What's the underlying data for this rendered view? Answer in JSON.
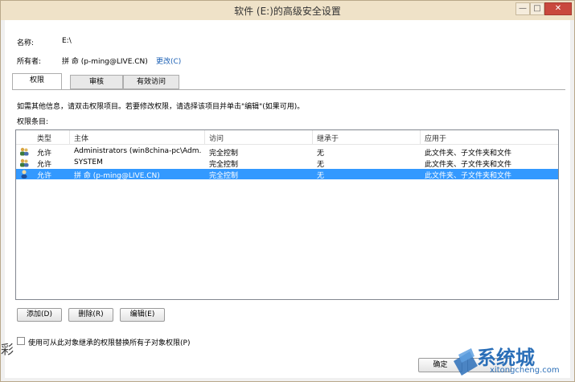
{
  "window": {
    "title": "软件 (E:)的高级安全设置",
    "min_glyph": "—",
    "max_glyph": "□",
    "close_glyph": "✕"
  },
  "header": {
    "name_label": "名称:",
    "name_value": "E:\\",
    "owner_label": "所有者:",
    "owner_value": "拼 命 (p-ming@LIVE.CN)",
    "change_link": "更改(C)"
  },
  "tabs": [
    {
      "label": "权限",
      "active": true
    },
    {
      "label": "审核",
      "active": false
    },
    {
      "label": "有效访问",
      "active": false
    }
  ],
  "info_text": "如需其他信息，请双击权限项目。若要修改权限，请选择该项目并单击\"编辑\"(如果可用)。",
  "entries_label": "权限条目:",
  "table": {
    "columns": [
      "类型",
      "主体",
      "访问",
      "继承于",
      "应用于"
    ],
    "rows": [
      {
        "type": "允许",
        "principal": "Administrators (win8china-pc\\Adm...",
        "access": "完全控制",
        "inherited": "无",
        "applies": "此文件夹、子文件夹和文件",
        "icon": "group-icon",
        "selected": false
      },
      {
        "type": "允许",
        "principal": "SYSTEM",
        "access": "完全控制",
        "inherited": "无",
        "applies": "此文件夹、子文件夹和文件",
        "icon": "group-icon",
        "selected": false
      },
      {
        "type": "允许",
        "principal": "拼 命 (p-ming@LIVE.CN)",
        "access": "完全控制",
        "inherited": "无",
        "applies": "此文件夹、子文件夹和文件",
        "icon": "user-icon",
        "selected": true
      }
    ]
  },
  "buttons": {
    "add": "添加(D)",
    "remove": "删除(R)",
    "edit": "编辑(E)"
  },
  "replace_checkbox_label": "使用可从此对象继承的权限替换所有子对象权限(P)",
  "ok_label": "确定",
  "watermark": {
    "title": "系统城",
    "url": "xitongcheng.com"
  },
  "colors": {
    "selection": "#3399ff",
    "titlebar": "#efe2c8",
    "link": "#1a5fb4",
    "watermark": "#2b6fb8"
  }
}
